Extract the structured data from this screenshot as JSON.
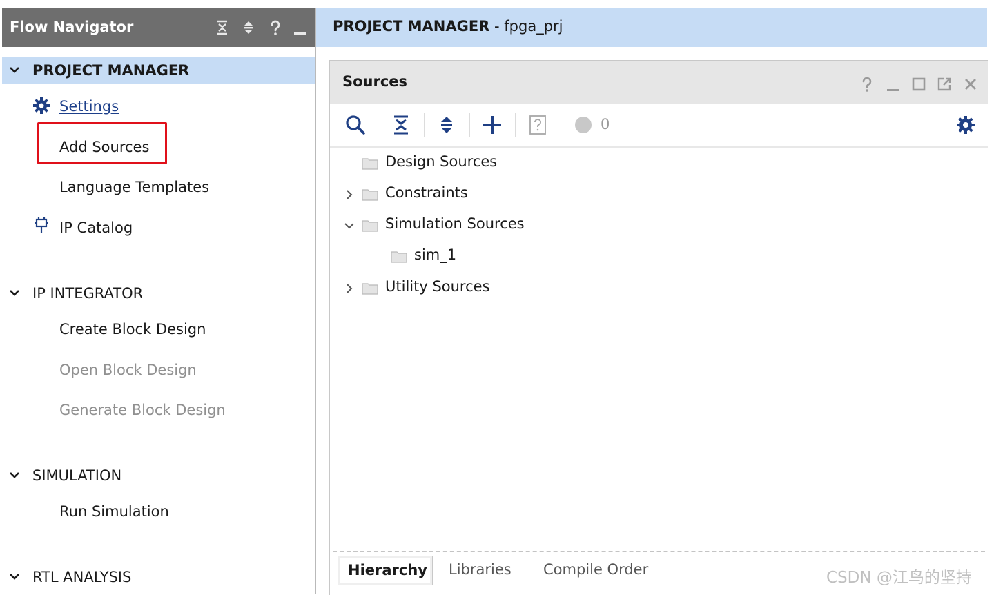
{
  "flow_navigator": {
    "title": "Flow Navigator",
    "header_icons": [
      "collapse-all-icon",
      "expand-all-icon",
      "help-icon",
      "minimize-icon"
    ],
    "sections": [
      {
        "label": "PROJECT MANAGER",
        "expanded": true,
        "active": true,
        "items": [
          {
            "label": "Settings",
            "icon": "gear-icon",
            "style": "link"
          },
          {
            "label": "Add Sources",
            "highlighted": true
          },
          {
            "label": "Language Templates"
          },
          {
            "label": "IP Catalog",
            "icon": "ip-plug-icon"
          }
        ]
      },
      {
        "label": "IP INTEGRATOR",
        "expanded": true,
        "items": [
          {
            "label": "Create Block Design"
          },
          {
            "label": "Open Block Design",
            "disabled": true
          },
          {
            "label": "Generate Block Design",
            "disabled": true
          }
        ]
      },
      {
        "label": "SIMULATION",
        "expanded": true,
        "items": [
          {
            "label": "Run Simulation"
          }
        ]
      },
      {
        "label": "RTL ANALYSIS",
        "expanded": true,
        "items": []
      }
    ]
  },
  "project_manager": {
    "title_strong": "PROJECT MANAGER",
    "title_suffix": " - fpga_prj"
  },
  "sources": {
    "title": "Sources",
    "window_controls": [
      "help-icon",
      "minimize-icon",
      "maximize-icon",
      "float-icon",
      "close-icon"
    ],
    "toolbar": {
      "buttons": [
        "search-icon",
        "collapse-all-icon",
        "expand-all-icon",
        "add-icon",
        "unknown-file-icon"
      ],
      "status_count": "0"
    },
    "tree": [
      {
        "label": "Design Sources",
        "expandable": false,
        "level": 0
      },
      {
        "label": "Constraints",
        "expandable": true,
        "expanded": false,
        "level": 0
      },
      {
        "label": "Simulation Sources",
        "expandable": true,
        "expanded": true,
        "level": 0
      },
      {
        "label": "sim_1",
        "expandable": false,
        "level": 1
      },
      {
        "label": "Utility Sources",
        "expandable": true,
        "expanded": false,
        "level": 0
      }
    ],
    "tabs": [
      {
        "label": "Hierarchy",
        "active": true
      },
      {
        "label": "Libraries",
        "active": false
      },
      {
        "label": "Compile Order",
        "active": false
      }
    ]
  },
  "watermark": "CSDN @江鸟的坚持",
  "colors": {
    "nav_header_bg": "#6e6e6e",
    "active_section_bg": "#c6dcf5",
    "highlight_border": "#e0101a",
    "link_color": "#1d3f8a",
    "icon_blue": "#1f3f84",
    "disabled_text": "#909090"
  }
}
